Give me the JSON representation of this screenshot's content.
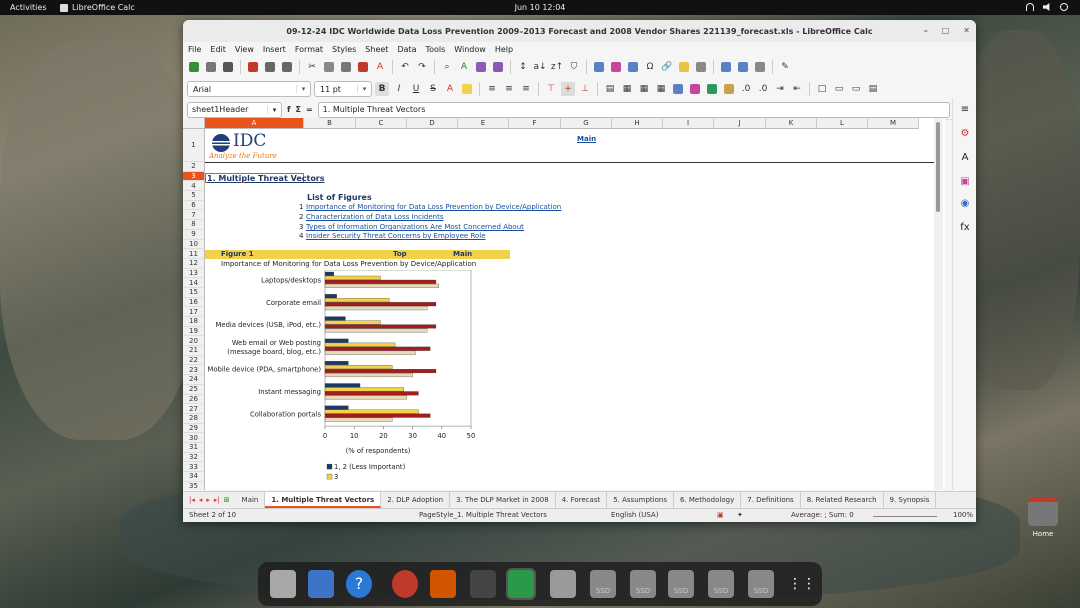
{
  "topbar": {
    "activities": "Activities",
    "app_name": "LibreOffice Calc",
    "clock": "Jun 10  12:04"
  },
  "window": {
    "title": "09-12-24 IDC Worldwide Data Loss Prevention 2009–2013 Forecast and 2008 Vendor Shares 221139_forecast.xls - LibreOffice Calc",
    "controls": [
      "–",
      "□",
      "✕"
    ]
  },
  "menu": [
    "File",
    "Edit",
    "View",
    "Insert",
    "Format",
    "Styles",
    "Sheet",
    "Data",
    "Tools",
    "Window",
    "Help"
  ],
  "format_toolbar": {
    "font_name": "Arial",
    "font_size": "11 pt"
  },
  "formula_bar": {
    "name_box": "sheet1Header",
    "fx": "f",
    "sigma": "Σ",
    "equals": "=",
    "content": "1. Multiple Threat Vectors"
  },
  "columns": [
    "A",
    "B",
    "C",
    "D",
    "E",
    "F",
    "G",
    "H",
    "I",
    "J",
    "K",
    "L",
    "M"
  ],
  "rows": [
    "1",
    "2",
    "3",
    "4",
    "5",
    "6",
    "7",
    "8",
    "9",
    "10",
    "11",
    "12",
    "13",
    "14",
    "15",
    "16",
    "17",
    "18",
    "19",
    "20",
    "21",
    "22",
    "23",
    "24",
    "25",
    "26",
    "27",
    "28",
    "29",
    "30",
    "31",
    "32",
    "33",
    "34",
    "35"
  ],
  "sheet": {
    "logo_text": "IDC",
    "logo_tagline": "Analyze the Future",
    "main_link": "Main",
    "section_title": "1. Multiple Threat Vectors",
    "list_title": "List of Figures",
    "figures": [
      {
        "num": "1",
        "label": "Importance of Monitoring for Data Loss Prevention by Device/Application"
      },
      {
        "num": "2",
        "label": "Characterization of Data Loss Incidents"
      },
      {
        "num": "3",
        "label": "Types of Information Organizations Are Most Concerned About"
      },
      {
        "num": "4",
        "label": "Insider Security Threat Concerns by Employee Role"
      }
    ],
    "figure_header": "Figure 1",
    "top_link": "Top",
    "main_link2": "Main",
    "figure_caption": "Importance of Monitoring for Data Loss Prevention by Device/Application"
  },
  "chart_data": {
    "type": "bar",
    "orientation": "horizontal",
    "categories": [
      "Laptops/desktops",
      "Corporate email",
      "Media devices (USB, iPod, etc.)",
      "Web email or Web posting (message board, blog, etc.)",
      "Mobile device (PDA, smartphone)",
      "Instant messaging",
      "Collaboration portals"
    ],
    "category_lines": [
      [
        "Laptops/desktops"
      ],
      [
        "Corporate email"
      ],
      [
        "Media devices (USB, iPod, etc.)"
      ],
      [
        "Web email or Web posting",
        "(message board, blog, etc.)"
      ],
      [
        "Mobile device (PDA, smartphone)"
      ],
      [
        "Instant messaging"
      ],
      [
        "Collaboration portals"
      ]
    ],
    "series": [
      {
        "name": "1, 2 (Less Important)",
        "color": "#1f3864",
        "values": [
          3,
          4,
          7,
          8,
          8,
          12,
          8
        ]
      },
      {
        "name": "3",
        "color": "#f2d24b",
        "values": [
          19,
          22,
          19,
          24,
          23,
          27,
          32
        ]
      },
      {
        "name": "",
        "color": "#a31d1d",
        "values": [
          38,
          38,
          38,
          36,
          38,
          32,
          36
        ]
      },
      {
        "name": "",
        "color": "#e8d9b8",
        "values": [
          39,
          35,
          35,
          31,
          30,
          28,
          23
        ]
      }
    ],
    "xlim": [
      0,
      50
    ],
    "xticks": [
      0,
      10,
      20,
      30,
      40,
      50
    ],
    "xlabel": "(% of respondents)",
    "grid": false,
    "legend": "bottom"
  },
  "tabs": [
    "Main",
    "1. Multiple Threat Vectors",
    "2. DLP Adoption",
    "3. The DLP Market in 2008",
    "4. Forecast",
    "5. Assumptions",
    "6. Methodology",
    "7. Definitions",
    "8. Related Research",
    "9. Synopsis"
  ],
  "active_tab": "1. Multiple Threat Vectors",
  "status": {
    "sheet": "Sheet 2 of 10",
    "page_style": "PageStyle_1. Multiple Threat Vectors",
    "language": "English (USA)",
    "sum": "Average: ; Sum: 0",
    "zoom": "100%"
  },
  "dock": {
    "ssd_label": "SSD",
    "home_label": "Home"
  },
  "colors": {
    "accent": "#e8541c",
    "link": "#1a4fa0",
    "highlight_row": "#f2d24b"
  }
}
